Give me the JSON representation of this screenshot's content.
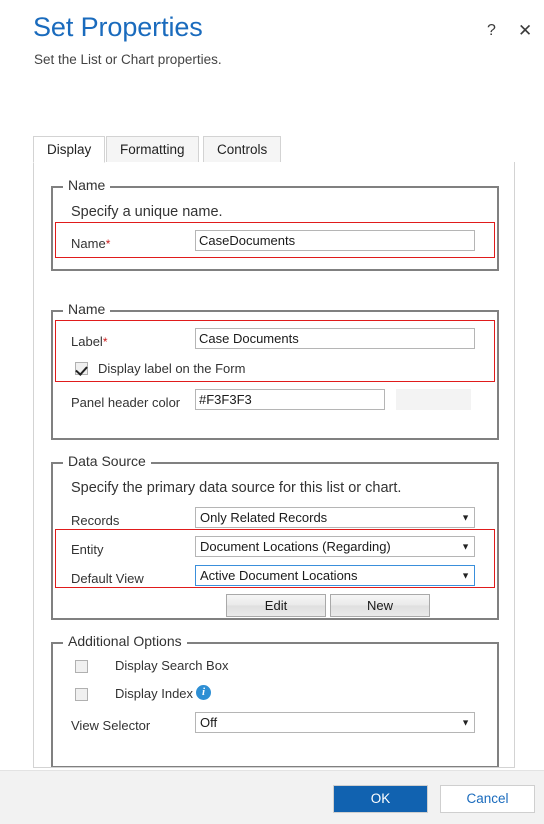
{
  "header": {
    "title": "Set Properties",
    "subtitle": "Set the List or Chart properties.",
    "help_icon": "?",
    "close_icon": "✕"
  },
  "tabs": [
    {
      "label": "Display",
      "active": true
    },
    {
      "label": "Formatting",
      "active": false
    },
    {
      "label": "Controls",
      "active": false
    }
  ],
  "sections": {
    "name_unique": {
      "legend": "Name",
      "description": "Specify a unique name.",
      "name_label": "Name",
      "required_marker": "*",
      "name_value": "CaseDocuments"
    },
    "name_label_section": {
      "legend": "Name",
      "label_label": "Label",
      "required_marker": "*",
      "label_value": "Case Documents",
      "display_label_checkbox": "Display label on the Form",
      "display_label_checked": true,
      "panel_header_color_label": "Panel header color",
      "panel_header_color_value": "#F3F3F3",
      "panel_header_color_swatch": "#F3F3F3"
    },
    "data_source": {
      "legend": "Data Source",
      "description": "Specify the primary data source for this list or chart.",
      "records_label": "Records",
      "records_value": "Only Related Records",
      "entity_label": "Entity",
      "entity_value": "Document Locations (Regarding)",
      "default_view_label": "Default View",
      "default_view_value": "Active Document Locations",
      "edit_button": "Edit",
      "new_button": "New"
    },
    "additional_options": {
      "legend": "Additional Options",
      "display_search_box_label": "Display Search Box",
      "display_search_box_checked": false,
      "display_index_label": "Display Index",
      "display_index_checked": false,
      "display_index_info_icon": "i",
      "view_selector_label": "View Selector",
      "view_selector_value": "Off"
    }
  },
  "footer": {
    "ok_label": "OK",
    "cancel_label": "Cancel"
  },
  "dropdown_arrow": "▼",
  "colors": {
    "title": "#1a6bbd",
    "primary_button": "#1162b0",
    "link": "#1a6bbd",
    "validation_highlight": "#e01b1b",
    "focus_border": "#3a8fdb",
    "info_icon": "#2e8fd4"
  }
}
